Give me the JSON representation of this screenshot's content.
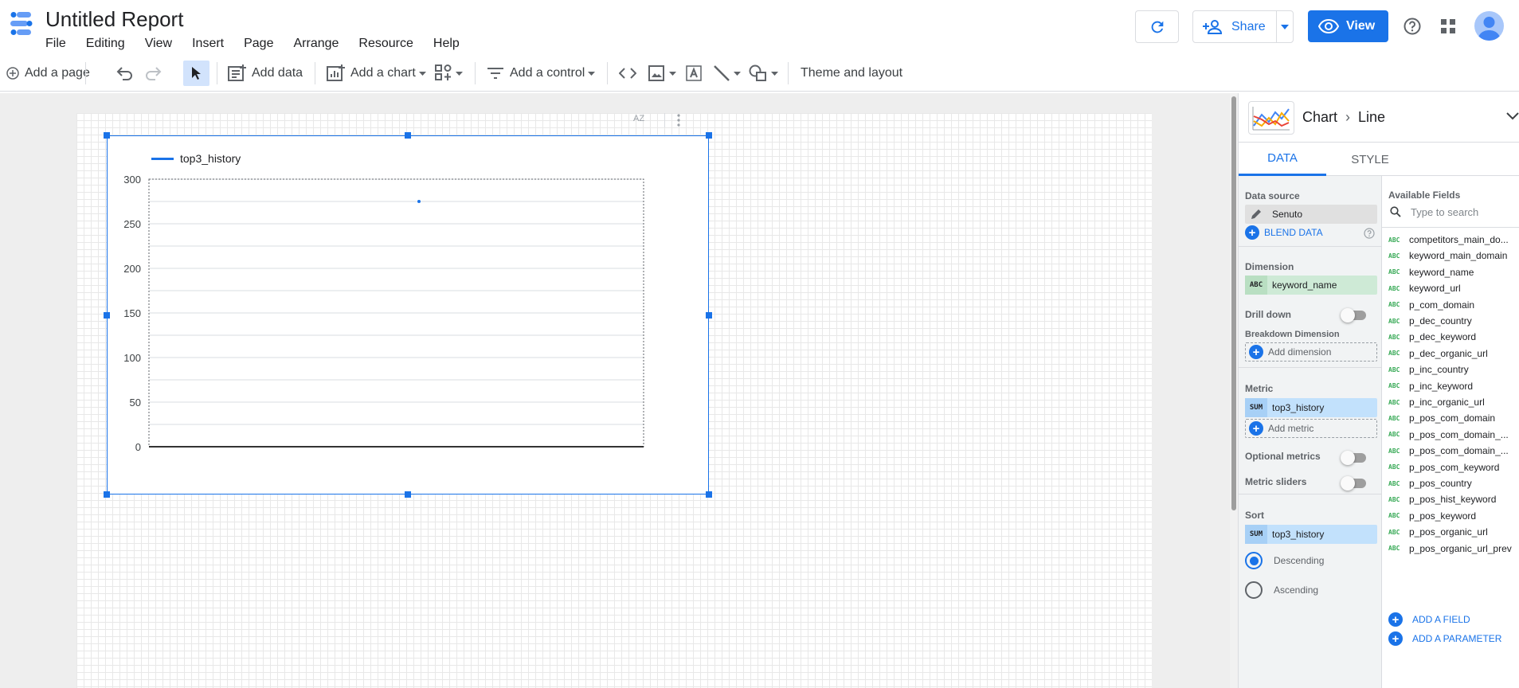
{
  "app": {
    "title": "Untitled Report",
    "menu": [
      "File",
      "Editing",
      "View",
      "Insert",
      "Page",
      "Arrange",
      "Resource",
      "Help"
    ],
    "share_label": "Share",
    "view_label": "View"
  },
  "toolbar": {
    "add_page": "Add a page",
    "add_data": "Add data",
    "add_chart": "Add a chart",
    "add_control": "Add a control",
    "theme_layout": "Theme and layout"
  },
  "chart": {
    "sort_badge": "AZ",
    "legend": "top3_history"
  },
  "chart_data": {
    "type": "line",
    "series": [
      {
        "name": "top3_history",
        "values": []
      }
    ],
    "y_ticks": [
      "300",
      "250",
      "200",
      "150",
      "100",
      "50",
      "0"
    ],
    "ylim": [
      0,
      300
    ],
    "grid": true,
    "legend_position": "top-left"
  },
  "panel": {
    "chart_group": "Chart",
    "chart_type": "Line",
    "tabs": [
      "DATA",
      "STYLE"
    ],
    "data_source_label": "Data source",
    "data_source": "Senuto",
    "blend_data": "BLEND DATA",
    "dimension_label": "Dimension",
    "dimension_tag": "ABC",
    "dimension": "keyword_name",
    "drill_down_label": "Drill down",
    "breakdown_label": "Breakdown Dimension",
    "add_dimension": "Add dimension",
    "metric_label": "Metric",
    "metric_tag": "SUM",
    "metric": "top3_history",
    "add_metric": "Add metric",
    "optional_metrics_label": "Optional metrics",
    "metric_sliders_label": "Metric sliders",
    "sort_label": "Sort",
    "sort_tag": "SUM",
    "sort_field": "top3_history",
    "descending": "Descending",
    "ascending": "Ascending"
  },
  "fields": {
    "title": "Available Fields",
    "search_placeholder": "Type to search",
    "type_tag": "ABC",
    "items": [
      "competitors_main_do...",
      "keyword_main_domain",
      "keyword_name",
      "keyword_url",
      "p_com_domain",
      "p_dec_country",
      "p_dec_keyword",
      "p_dec_organic_url",
      "p_inc_country",
      "p_inc_keyword",
      "p_inc_organic_url",
      "p_pos_com_domain",
      "p_pos_com_domain_...",
      "p_pos_com_domain_...",
      "p_pos_com_keyword",
      "p_pos_country",
      "p_pos_hist_keyword",
      "p_pos_keyword",
      "p_pos_organic_url",
      "p_pos_organic_url_prev"
    ],
    "add_field": "ADD A FIELD",
    "add_parameter": "ADD A PARAMETER"
  },
  "colors": {
    "accent": "#1a73e8",
    "dimension_chip": "#ceead6",
    "metric_chip": "#c2e1fc"
  }
}
